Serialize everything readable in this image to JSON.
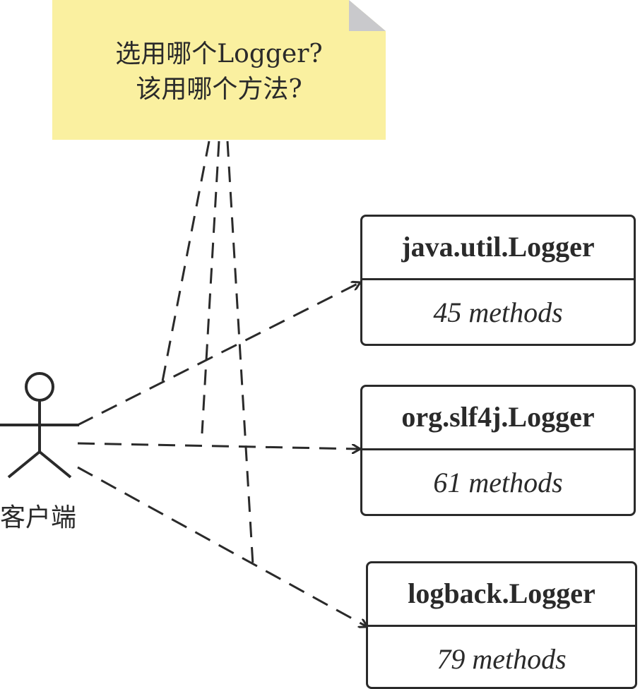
{
  "note": {
    "line1": "选用哪个Logger?",
    "line2": "该用哪个方法?"
  },
  "actor": {
    "label": "客户端"
  },
  "classes": [
    {
      "name": "java.util.Logger",
      "methods": "45 methods"
    },
    {
      "name": "org.slf4j.Logger",
      "methods": "61 methods"
    },
    {
      "name": "logback.Logger",
      "methods": "79 methods"
    }
  ],
  "colors": {
    "note_fill": "#faf0a0",
    "note_fold": "#c9c9cc",
    "stroke": "#2a2a2a"
  }
}
